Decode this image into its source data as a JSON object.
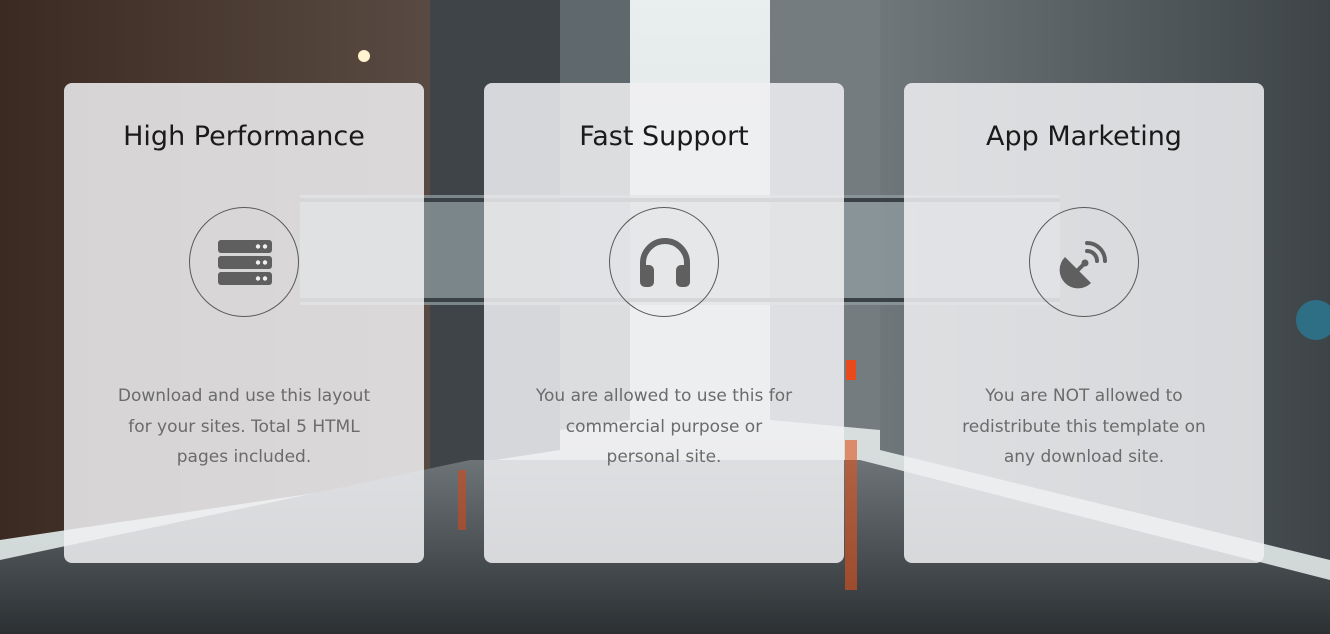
{
  "features": [
    {
      "title": "High Performance",
      "icon": "server-icon",
      "text": "Download and use this layout for your sites. Total 5 HTML pages included."
    },
    {
      "title": "Fast Support",
      "icon": "headphones-icon",
      "text": "You are allowed to use this for commercial purpose or personal site."
    },
    {
      "title": "App Marketing",
      "icon": "satellite-dish-icon",
      "text": "You are NOT allowed to redistribute this template on any download site."
    }
  ],
  "colors": {
    "card_background": "#f0f0f2",
    "title": "#1a1a1a",
    "body_text": "#6b6b6b",
    "icon": "#5a5a5a"
  }
}
